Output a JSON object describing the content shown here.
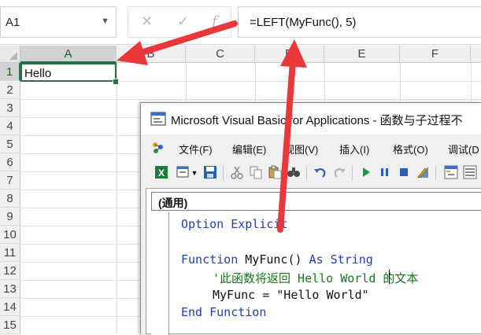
{
  "formula_bar": {
    "name_box": "A1",
    "cancel_glyph": "✕",
    "enter_glyph": "✓",
    "fx_glyph": "f",
    "formula": "=LEFT(MyFunc(), 5)"
  },
  "sheet": {
    "columns": [
      "A",
      "B",
      "C",
      "D",
      "E",
      "F"
    ],
    "rows": [
      "1",
      "2",
      "3",
      "4",
      "5",
      "6",
      "7",
      "8",
      "9",
      "10",
      "11",
      "12",
      "13",
      "14",
      "15"
    ],
    "cell_a1": "Hello"
  },
  "vba": {
    "title": "Microsoft Visual Basic for Applications - 函数与子过程不",
    "menu": [
      "文件(F)",
      "编辑(E)",
      "视图(V)",
      "插入(I)",
      "格式(O)",
      "调试(D"
    ],
    "object_combo": "(通用)",
    "code": {
      "line1": "Option Explicit",
      "line3_kw1": "Function",
      "line3_plain": " MyFunc() ",
      "line3_kw2": "As String",
      "line4": "'此函数将返回 Hello World 的文本",
      "line5": "MyFunc = \"Hello World\"",
      "line6": "End Function"
    }
  },
  "colors": {
    "excel_green": "#217346",
    "arrow_red": "#e8383a",
    "vba_keyword": "#1f3fb0",
    "vba_comment": "#107c10"
  }
}
